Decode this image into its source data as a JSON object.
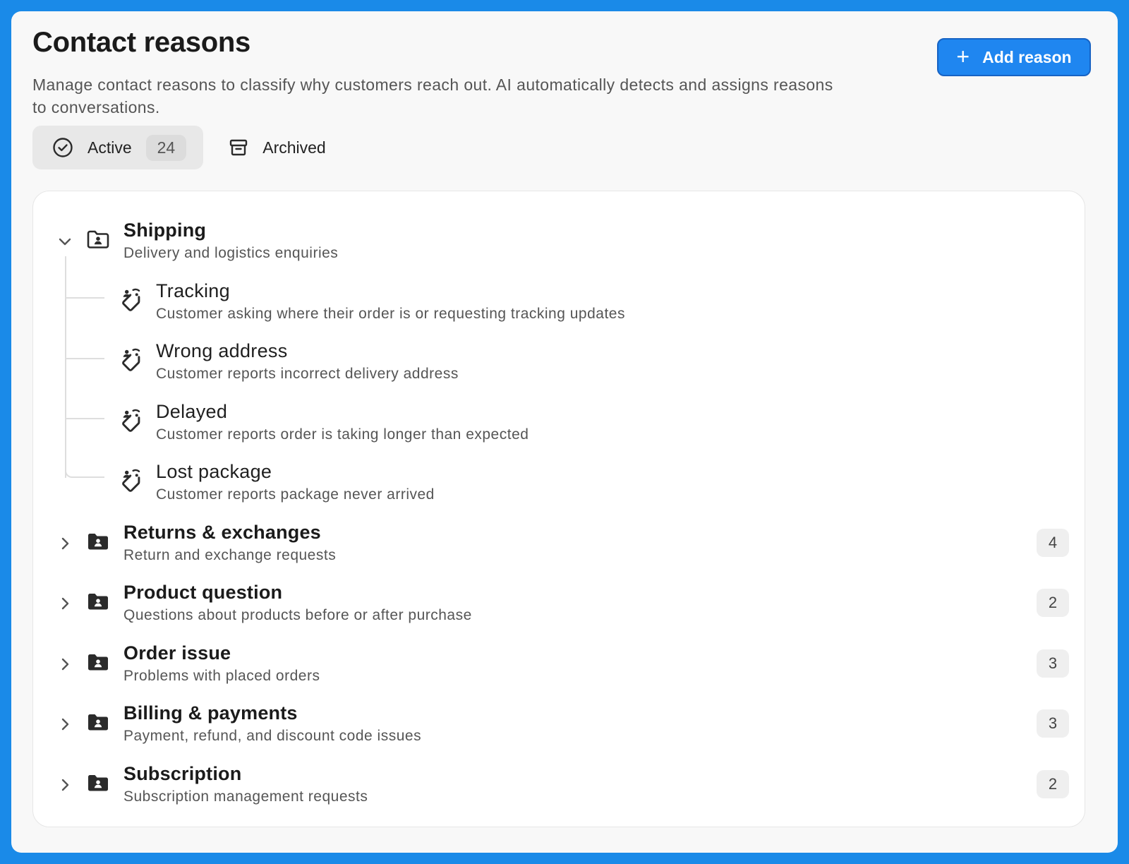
{
  "header": {
    "title": "Contact reasons",
    "description": "Manage contact reasons to classify why customers reach out. AI automatically detects and assigns reasons to conversations.",
    "add_button_label": "Add reason"
  },
  "tabs": {
    "active": {
      "label": "Active",
      "count": "24"
    },
    "archived": {
      "label": "Archived"
    }
  },
  "groups": [
    {
      "title": "Shipping",
      "description": "Delivery and logistics enquiries",
      "expanded": true,
      "children": [
        {
          "title": "Tracking",
          "description": "Customer asking where their order is or requesting tracking updates"
        },
        {
          "title": "Wrong address",
          "description": "Customer reports incorrect delivery address"
        },
        {
          "title": "Delayed",
          "description": "Customer reports order is taking longer than expected"
        },
        {
          "title": "Lost package",
          "description": "Customer reports package never arrived"
        }
      ]
    },
    {
      "title": "Returns & exchanges",
      "description": "Return and exchange requests",
      "count": "4",
      "expanded": false
    },
    {
      "title": "Product question",
      "description": "Questions about products before or after purchase",
      "count": "2",
      "expanded": false
    },
    {
      "title": "Order issue",
      "description": "Problems with placed orders",
      "count": "3",
      "expanded": false
    },
    {
      "title": "Billing & payments",
      "description": "Payment, refund, and discount code issues",
      "count": "3",
      "expanded": false
    },
    {
      "title": "Subscription",
      "description": "Subscription management requests",
      "count": "2",
      "expanded": false
    }
  ],
  "colors": {
    "accent": "#1f86f0",
    "frame": "#1a8ae8",
    "icon": "#2b2b2b"
  },
  "icons": {
    "add": "plus-icon",
    "active_tab": "check-circle-icon",
    "archived_tab": "archive-box-icon",
    "group": "folder-user-icon",
    "child": "tag-user-icon",
    "expanded": "chevron-down-icon",
    "collapsed": "chevron-right-icon"
  }
}
